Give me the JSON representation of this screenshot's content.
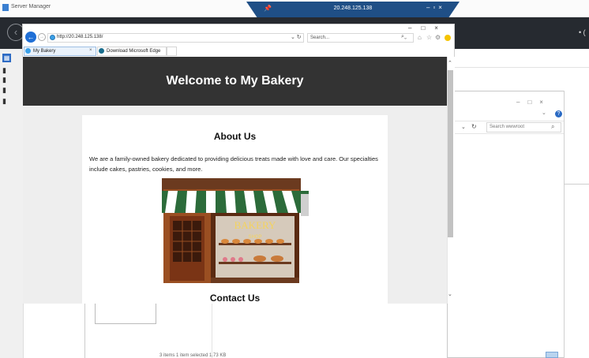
{
  "server_manager": {
    "title": "Server Manager",
    "flag": "• ("
  },
  "rdp_bar": {
    "ip": "20.248.125.138"
  },
  "browser": {
    "url": "http://20.248.125.138/",
    "search_placeholder": "Search...",
    "tabs": [
      {
        "label": "My Bakery"
      },
      {
        "label": "Download Microsoft Edge"
      }
    ]
  },
  "page": {
    "header": "Welcome to My Bakery",
    "about_title": "About Us",
    "about_text": "We are a family-owned bakery dedicated to providing delicious treats made with love and care. Our specialties include cakes, pastries, cookies, and more.",
    "bakery_sign": "BAKERY",
    "shop_sign": "SHOP",
    "contact_title": "Contact Us"
  },
  "file_explorer": {
    "search_placeholder": "Search wwwroot",
    "status": "3 items    1 item selected  1.73 KB"
  },
  "colors": {
    "header_bg": "#333333",
    "page_bg": "#eeeeee",
    "ie_blue": "#1f6fd6",
    "rdp_bar": "#1f4f86"
  }
}
